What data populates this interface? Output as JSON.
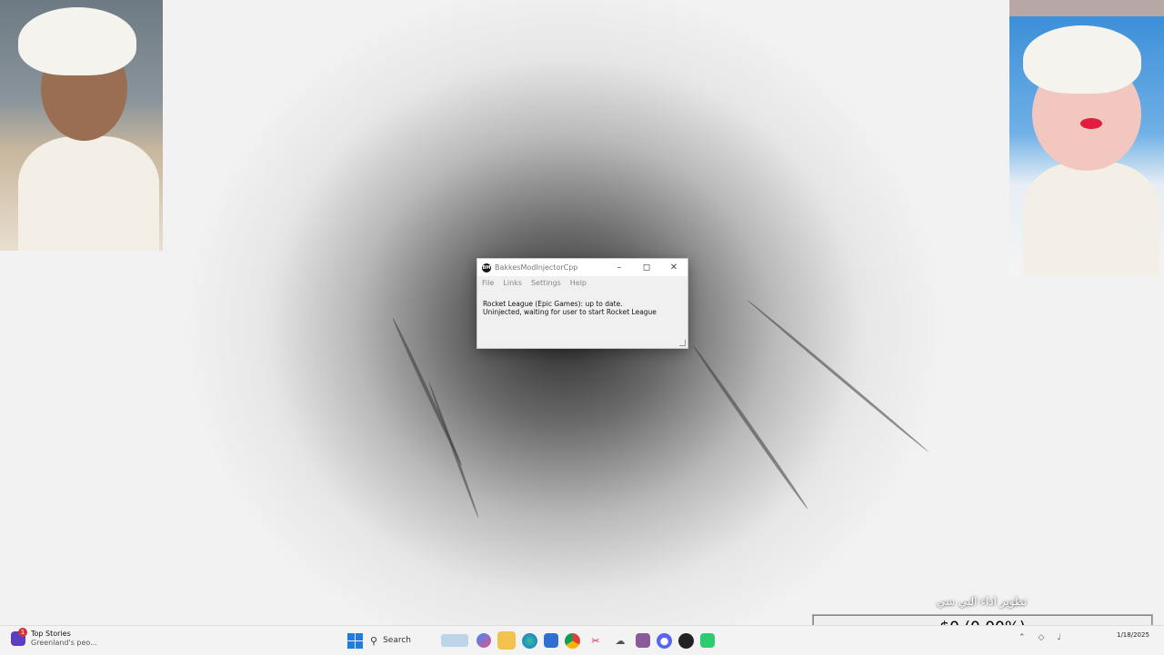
{
  "window": {
    "title": "BakkesModInjectorCpp",
    "menu": [
      "File",
      "Links",
      "Settings",
      "Help"
    ],
    "status_line_1": "Rocket League (Epic Games): up to date.",
    "status_line_2": "Uninjected, waiting for user to start Rocket League"
  },
  "overlay": {
    "arabic_caption": "تطوير اداء البي سي",
    "money": "$0 (0.00%)"
  },
  "taskbar": {
    "news_badge": "1",
    "news_title": "Top Stories",
    "news_subtitle": "Greenland's peo...",
    "search_label": "Search",
    "clock_date": "1/18/2025"
  },
  "colors": {
    "accent": "#1f7be0",
    "news": "#5a3fc0",
    "badge": "#d13438"
  }
}
